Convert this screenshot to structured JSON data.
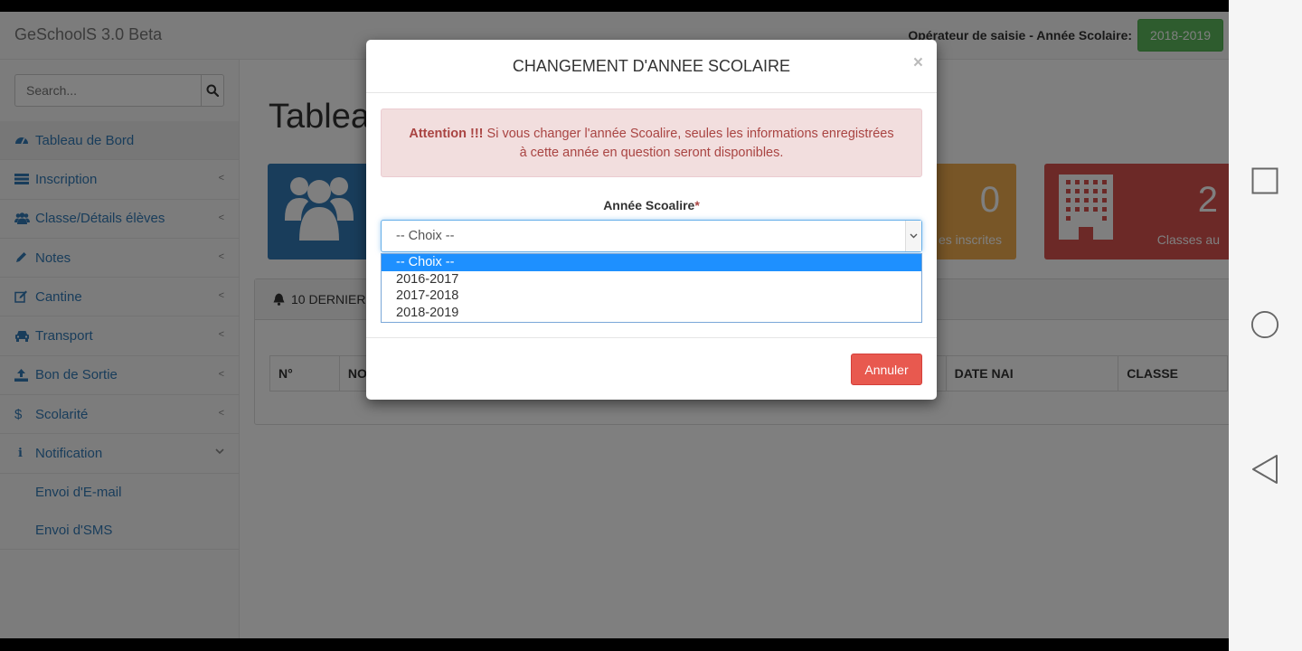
{
  "navbar": {
    "brand": "GeSchoolS 3.0 Beta",
    "operator_text": "Opérateur de saisie - Année Scolaire:",
    "current_year": "2018-2019"
  },
  "sidebar": {
    "search_placeholder": "Search...",
    "items": [
      {
        "label": "Tableau de Bord",
        "icon": "dashboard-icon"
      },
      {
        "label": "Inscription",
        "icon": "list-icon"
      },
      {
        "label": "Classe/Détails élèves",
        "icon": "users-icon"
      },
      {
        "label": "Notes",
        "icon": "pencil-icon"
      },
      {
        "label": "Cantine",
        "icon": "edit-icon"
      },
      {
        "label": "Transport",
        "icon": "car-icon"
      },
      {
        "label": "Bon de Sortie",
        "icon": "upload-icon"
      },
      {
        "label": "Scolarité",
        "icon": "dollar-icon"
      },
      {
        "label": "Notification",
        "icon": "info-icon"
      }
    ],
    "sub_items": [
      "Envoi d'E-mail",
      "Envoi d'SMS"
    ]
  },
  "main": {
    "title": "Tablea",
    "tiles": [
      {
        "number": "0",
        "label": "es inscrites",
        "color": "#f0ad4e"
      },
      {
        "number": "2",
        "label": "Classes au",
        "color": "#d9534f"
      }
    ],
    "panel_title": "10 DERNIER",
    "table_headers": [
      "N°",
      "NO",
      "DATE NAI",
      "CLASSE"
    ]
  },
  "modal": {
    "title": "CHANGEMENT D'ANNEE SCOLAIRE",
    "close": "×",
    "alert_strong": "Attention !!!",
    "alert_line1": " Si vous changer l'année Scoalire, seules les informations enregistrées",
    "alert_line2": "à cette année en question seront disponibles.",
    "field_label": "Année Scoalire",
    "required_mark": "*",
    "select_value": "-- Choix --",
    "options": [
      "-- Choix --",
      "2016-2017",
      "2017-2018",
      "2018-2019"
    ],
    "cancel_label": "Annuler"
  }
}
